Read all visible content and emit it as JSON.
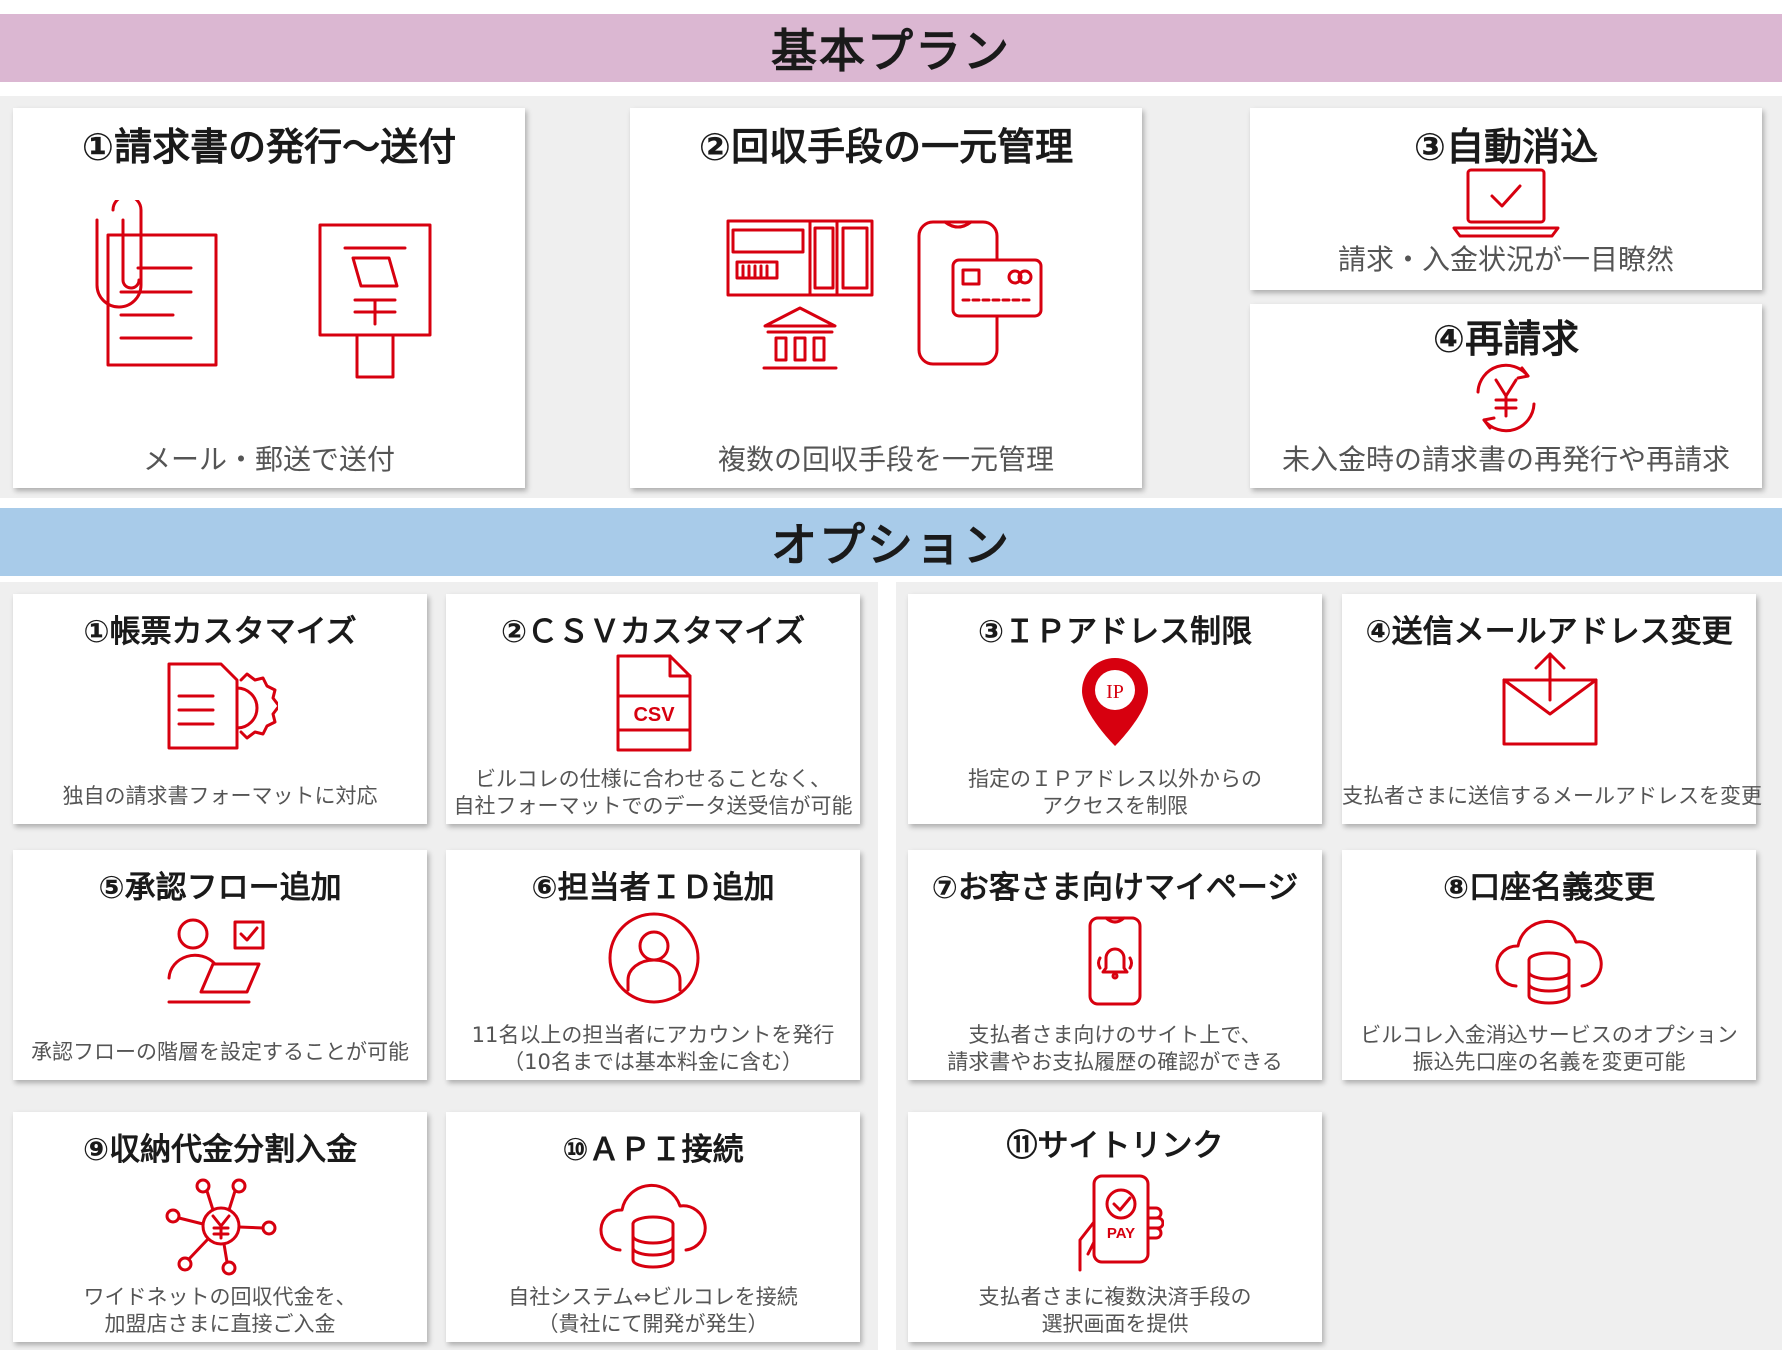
{
  "basic_plan": {
    "heading": "基本プラン",
    "cards": [
      {
        "title": "①請求書の発行〜送付",
        "desc": "メール・郵送で送付",
        "icons": [
          "document-clip-icon",
          "postbox-icon"
        ]
      },
      {
        "title": "②回収手段の一元管理",
        "desc": "複数の回収手段を一元管理",
        "icons": [
          "payment-slip-icon",
          "bank-icon",
          "smartphone-card-icon"
        ]
      },
      {
        "title": "③自動消込",
        "desc": "請求・入金状況が一目瞭然",
        "icons": [
          "laptop-check-icon"
        ]
      },
      {
        "title": "④再請求",
        "desc": "未入金時の請求書の再発行や再請求",
        "icons": [
          "yen-cycle-icon"
        ]
      }
    ]
  },
  "options": {
    "heading": "オプション",
    "cards": [
      {
        "title": "①帳票カスタマイズ",
        "desc": [
          "独自の請求書フォーマットに対応"
        ],
        "icon": "document-gear-icon"
      },
      {
        "title": "②ＣＳＶカスタマイズ",
        "desc": [
          "ビルコレの仕様に合わせることなく、",
          "自社フォーマットでのデータ送受信が可能"
        ],
        "icon": "csv-file-icon",
        "icon_label": "CSV"
      },
      {
        "title": "③ＩＰアドレス制限",
        "desc": [
          "指定のＩＰアドレス以外からの",
          "アクセスを制限"
        ],
        "icon": "ip-pin-icon",
        "icon_label": "IP"
      },
      {
        "title": "④送信メールアドレス変更",
        "desc": [
          "支払者さまに送信するメールアドレスを変更"
        ],
        "icon": "mail-upload-icon"
      },
      {
        "title": "⑤承認フロー追加",
        "desc": [
          "承認フローの階層を設定することが可能"
        ],
        "icon": "user-laptop-check-icon"
      },
      {
        "title": "⑥担当者ＩＤ追加",
        "desc": [
          "11名以上の担当者にアカウントを発行",
          "（10名までは基本料金に含む）"
        ],
        "icon": "user-circle-icon"
      },
      {
        "title": "⑦お客さま向けマイページ",
        "desc": [
          "支払者さま向けのサイト上で、",
          "請求書やお支払履歴の確認ができる"
        ],
        "icon": "phone-bell-icon"
      },
      {
        "title": "⑧口座名義変更",
        "desc": [
          "ビルコレ入金消込サービスのオプション",
          "振込先口座の名義を変更可能"
        ],
        "icon": "cloud-database-icon"
      },
      {
        "title": "⑨収納代金分割入金",
        "desc": [
          "ワイドネットの回収代金を、",
          "加盟店さまに直接ご入金"
        ],
        "icon": "yen-network-icon"
      },
      {
        "title": "⑩ＡＰＩ接続",
        "desc": [
          "自社システム⇔ビルコレを接続",
          "（貴社にて開発が発生）"
        ],
        "icon": "cloud-database-icon"
      },
      {
        "title": "⑪サイトリンク",
        "desc": [
          "支払者さまに複数決済手段の",
          "選択画面を提供"
        ],
        "icon": "hand-phone-pay-icon",
        "icon_label": "PAY"
      }
    ]
  },
  "colors": {
    "accent": "#d7000f",
    "basic_band": "#dbb7d2",
    "option_band": "#a8cbe9",
    "panel_bg": "#efefef"
  }
}
